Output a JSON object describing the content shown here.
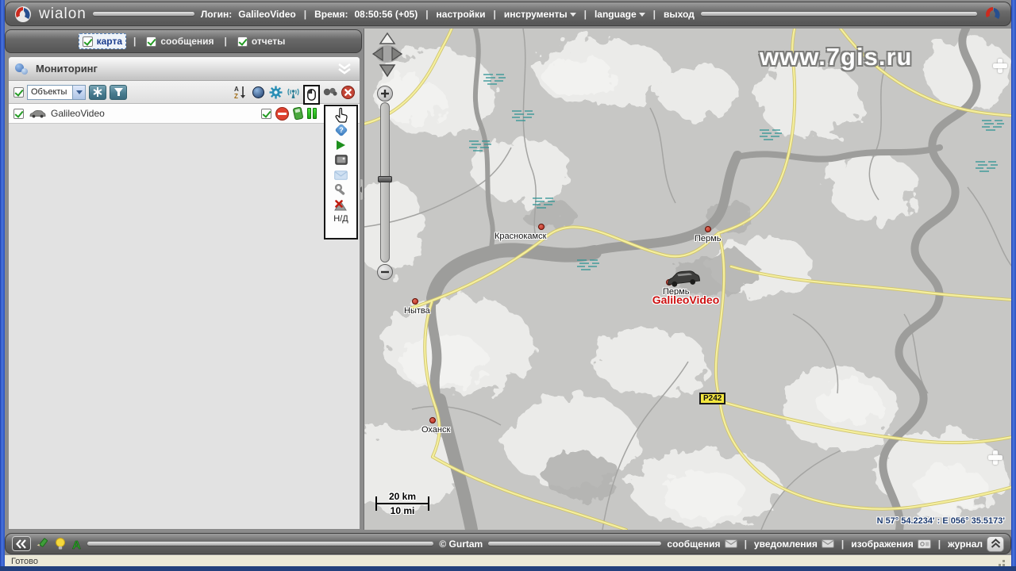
{
  "ui": {
    "sep": "|"
  },
  "topbar": {
    "brand": "wialon",
    "login_label": "Логин:",
    "login_value": "GalileoVideo",
    "time_label": "Время:",
    "time_value": "08:50:56 (+05)",
    "menu_settings": "настройки",
    "menu_tools": "инструменты",
    "menu_language": "language",
    "menu_exit": "выход"
  },
  "tabs": {
    "map": "карта",
    "messages": "сообщения",
    "reports": "отчеты"
  },
  "panel": {
    "title": "Мониторинг",
    "objects_label": "Объекты",
    "unit_name": "GalileoVideo",
    "popup_na_label": "Н/Д"
  },
  "icons": {
    "sort_a": "A",
    "sort_z": "Z",
    "sort_arrow": "↓",
    "question_mark": "?",
    "marker_a": "A"
  },
  "map": {
    "watermark": "www.7gis.ru",
    "city_krasnokamsk": "Краснокамск",
    "city_perm_north": "Пермь",
    "city_perm": "Пермь",
    "city_nytva": "Нытва",
    "city_okhansk": "Оханск",
    "unit_label": "GalileoVideo",
    "road_sign": "Р242",
    "scale_km": "20 km",
    "scale_mi": "10 mi",
    "coords": "N 57° 54.2234' : E 056° 35.5173'"
  },
  "bottombar": {
    "copyright": "© Gurtam",
    "messages": "сообщения",
    "notifications": "уведомления",
    "images": "изображения",
    "journal": "журнал"
  },
  "statusbar": {
    "ready": "Готово"
  },
  "colors": {
    "accent_green": "#23a31a",
    "alert_red": "#d93a28",
    "unit_label_red": "#cc1010",
    "road_yellow": "#f5ef9e"
  }
}
